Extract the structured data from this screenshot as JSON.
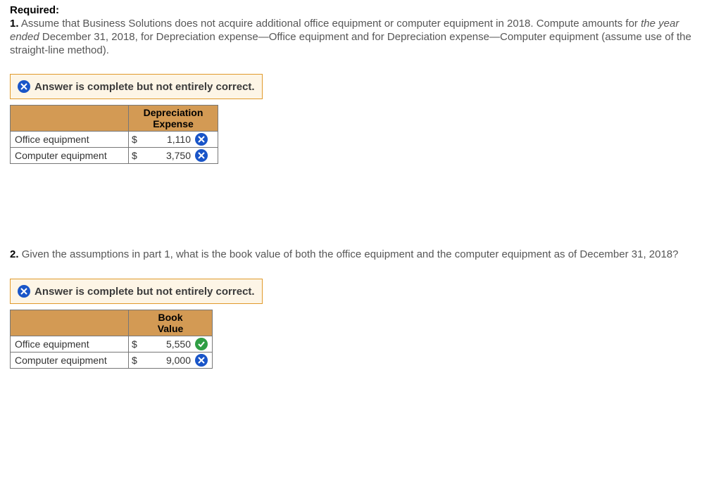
{
  "heading": "Required:",
  "q1": {
    "num": "1.",
    "text_a": "Assume that Business Solutions does not acquire additional office equipment or computer equipment in 2018. Compute amounts for ",
    "text_em": "the year ended",
    "text_b": " December 31, 2018, for Depreciation expense—Office equipment and for Depreciation expense—Computer equipment (assume use of the straight-line method)."
  },
  "alert": "Answer is complete but not entirely correct.",
  "table1": {
    "header": "Depreciation Expense",
    "rows": [
      {
        "label": "Office equipment",
        "currency": "$",
        "amount": "1,110",
        "status": "bad"
      },
      {
        "label": "Computer equipment",
        "currency": "$",
        "amount": "3,750",
        "status": "bad"
      }
    ]
  },
  "q2": {
    "num": "2.",
    "text": "Given the assumptions in part 1, what is the book value of both the office equipment and the computer equipment as of December 31, 2018?"
  },
  "table2": {
    "header": "Book Value",
    "rows": [
      {
        "label": "Office equipment",
        "currency": "$",
        "amount": "5,550",
        "status": "good"
      },
      {
        "label": "Computer equipment",
        "currency": "$",
        "amount": "9,000",
        "status": "bad"
      }
    ]
  }
}
